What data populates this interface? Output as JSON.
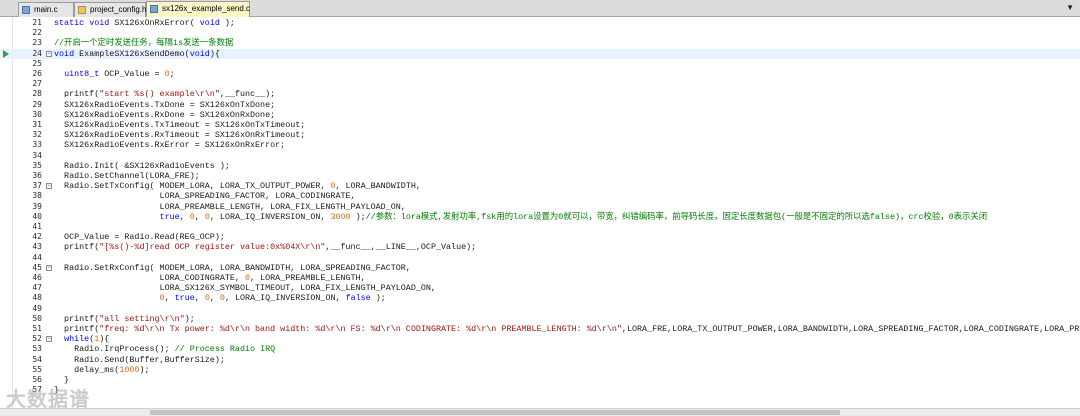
{
  "tabs": [
    {
      "label": "main.c",
      "type": "c"
    },
    {
      "label": "project_config.h",
      "type": "h"
    },
    {
      "label": "sx126x_example_send.c",
      "type": "c",
      "active": true
    }
  ],
  "tabbar_menu_icon": "dropdown-arrow-icon",
  "lines": [
    {
      "n": "21",
      "t": "static void SX126xOnRxError( void );"
    },
    {
      "n": "22",
      "t": ""
    },
    {
      "n": "23",
      "t": "//开启一个定时发送任务，每隔1s发送一条数据"
    },
    {
      "n": "24",
      "t": "void ExampleSX126xSendDemo(void){",
      "fold": true,
      "current": true
    },
    {
      "n": "25",
      "t": ""
    },
    {
      "n": "26",
      "t": "  uint8_t OCP_Value = 0;"
    },
    {
      "n": "27",
      "t": ""
    },
    {
      "n": "28",
      "t": "  printf(\"start %s() example\\r\\n\",__func__);"
    },
    {
      "n": "29",
      "t": "  SX126xRadioEvents.TxDone = SX126xOnTxDone;"
    },
    {
      "n": "30",
      "t": "  SX126xRadioEvents.RxDone = SX126xOnRxDone;"
    },
    {
      "n": "31",
      "t": "  SX126xRadioEvents.TxTimeout = SX126xOnTxTimeout;"
    },
    {
      "n": "32",
      "t": "  SX126xRadioEvents.RxTimeout = SX126xOnRxTimeout;"
    },
    {
      "n": "33",
      "t": "  SX126xRadioEvents.RxError = SX126xOnRxError;"
    },
    {
      "n": "34",
      "t": ""
    },
    {
      "n": "35",
      "t": "  Radio.Init( &SX126xRadioEvents );"
    },
    {
      "n": "36",
      "t": "  Radio.SetChannel(LORA_FRE);"
    },
    {
      "n": "37",
      "t": "  Radio.SetTxConfig( MODEM_LORA, LORA_TX_OUTPUT_POWER, 0, LORA_BANDWIDTH,",
      "fold": true
    },
    {
      "n": "38",
      "t": "                     LORA_SPREADING_FACTOR, LORA_CODINGRATE,"
    },
    {
      "n": "39",
      "t": "                     LORA_PREAMBLE_LENGTH, LORA_FIX_LENGTH_PAYLOAD_ON,"
    },
    {
      "n": "40",
      "t": "                     true, 0, 0, LORA_IQ_INVERSION_ON, 3000 );//参数：lora模式,发射功率,fsk用的lora设置为0就可以，带宽，纠错编码率，前导码长度，固定长度数据包(一般是不固定的所以选false)，crc校验，0表示关闭"
    },
    {
      "n": "41",
      "t": ""
    },
    {
      "n": "42",
      "t": "  OCP_Value = Radio.Read(REG_OCP);"
    },
    {
      "n": "43",
      "t": "  printf(\"[%s()-%d]read OCP register value:0x%04X\\r\\n\",__func__,__LINE__,OCP_Value);"
    },
    {
      "n": "44",
      "t": ""
    },
    {
      "n": "45",
      "t": "  Radio.SetRxConfig( MODEM_LORA, LORA_BANDWIDTH, LORA_SPREADING_FACTOR,",
      "fold": true
    },
    {
      "n": "46",
      "t": "                     LORA_CODINGRATE, 0, LORA_PREAMBLE_LENGTH,"
    },
    {
      "n": "47",
      "t": "                     LORA_SX126X_SYMBOL_TIMEOUT, LORA_FIX_LENGTH_PAYLOAD_ON,"
    },
    {
      "n": "48",
      "t": "                     0, true, 0, 0, LORA_IQ_INVERSION_ON, false );"
    },
    {
      "n": "49",
      "t": ""
    },
    {
      "n": "50",
      "t": "  printf(\"all setting\\r\\n\");"
    },
    {
      "n": "51",
      "t": "  printf(\"freq: %d\\r\\n Tx power: %d\\r\\n band width: %d\\r\\n FS: %d\\r\\n CODINGRATE: %d\\r\\n PREAMBLE_LENGTH: %d\\r\\n\",LORA_FRE,LORA_TX_OUTPUT_POWER,LORA_BANDWIDTH,LORA_SPREADING_FACTOR,LORA_CODINGRATE,LORA_PREAMBLE_LENGTH);"
    },
    {
      "n": "52",
      "t": "  while(1){",
      "fold": true
    },
    {
      "n": "53",
      "t": "    Radio.IrqProcess(); // Process Radio IRQ"
    },
    {
      "n": "54",
      "t": "    Radio.Send(Buffer,BufferSize);"
    },
    {
      "n": "55",
      "t": "    delay_ms(1000);"
    },
    {
      "n": "56",
      "t": "  }"
    },
    {
      "n": "57",
      "t": "}"
    }
  ],
  "colors": {
    "keyword": "#0000ff",
    "comment": "#008000",
    "string": "#a31515",
    "number": "#d2691e",
    "text": "#1a1a1a",
    "current_line": "#e8f2ff",
    "active_tab": "#fbf6c8"
  },
  "watermark": "大数据谱"
}
